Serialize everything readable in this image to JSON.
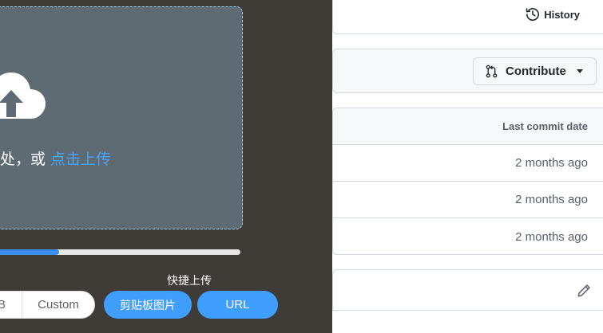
{
  "upload": {
    "drop_text_prefix": "此处，或 ",
    "click_upload_link": "点击上传",
    "progress": 0.27,
    "quick_upload_label": "快捷上传",
    "format_options": [
      {
        "label": "B",
        "selected": false
      },
      {
        "label": "Custom",
        "selected": false
      }
    ],
    "clipboard_button": "剪贴板图片",
    "url_button": "URL",
    "icons": {
      "cloud": "cloud-upload-icon"
    },
    "colors": {
      "panel_bg": "#3f3b37",
      "drop_zone_bg": "#5f6b73",
      "accent": "#409eff",
      "link": "#4aa3f2"
    }
  },
  "repo": {
    "history_label": "History",
    "contribute_label": "Contribute",
    "table": {
      "header": "Last commit date",
      "rows": [
        {
          "date": "2 months ago"
        },
        {
          "date": "2 months ago"
        },
        {
          "date": "2 months ago"
        }
      ]
    },
    "icons": {
      "history": "history-icon",
      "pull_request": "git-pull-request-icon",
      "edit": "pencil-icon",
      "caret": "caret-down-icon"
    }
  }
}
